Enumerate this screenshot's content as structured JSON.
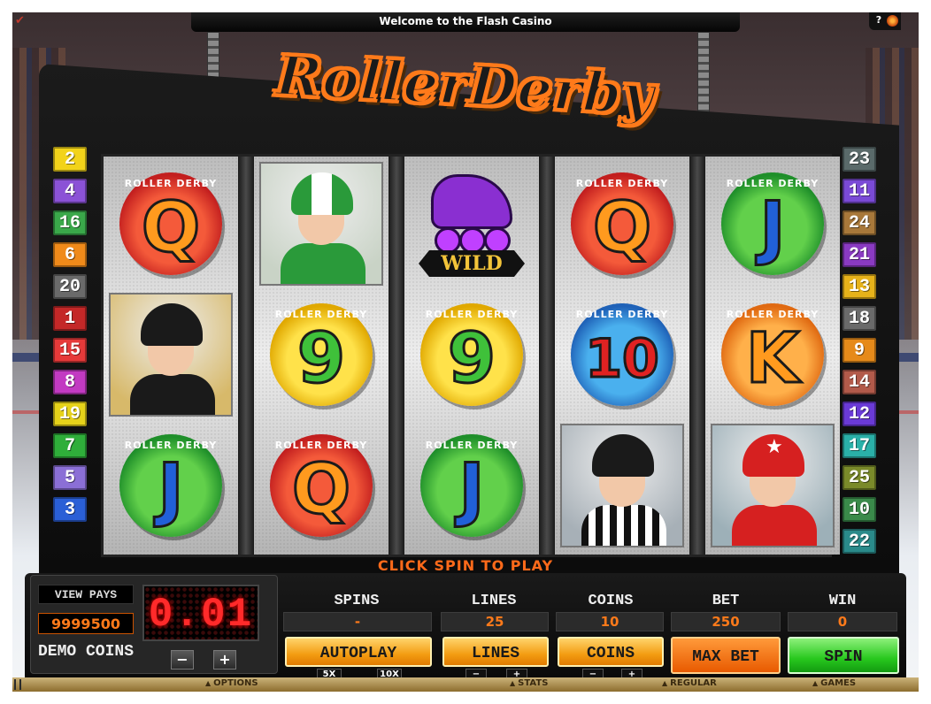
{
  "top_bar": {
    "title": "Welcome to the Flash Casino",
    "help_label": "?"
  },
  "logo": {
    "text": "RollerDerby"
  },
  "paylines_left": [
    {
      "n": "2",
      "color": "#f2d31a"
    },
    {
      "n": "4",
      "color": "#8b52d6"
    },
    {
      "n": "16",
      "color": "#3aa84a"
    },
    {
      "n": "6",
      "color": "#f08a1a"
    },
    {
      "n": "20",
      "color": "#6a6a6a"
    },
    {
      "n": "1",
      "color": "#c42828"
    },
    {
      "n": "15",
      "color": "#e63a3a"
    },
    {
      "n": "8",
      "color": "#c23ac2"
    },
    {
      "n": "19",
      "color": "#e6d21a"
    },
    {
      "n": "7",
      "color": "#2fae3a"
    },
    {
      "n": "5",
      "color": "#8b6fd6"
    },
    {
      "n": "3",
      "color": "#2a5fd6"
    }
  ],
  "paylines_right": [
    {
      "n": "23",
      "color": "#5a6a6a"
    },
    {
      "n": "11",
      "color": "#7a4ad6"
    },
    {
      "n": "24",
      "color": "#a8783a"
    },
    {
      "n": "21",
      "color": "#8a3ac2"
    },
    {
      "n": "13",
      "color": "#e6b21a"
    },
    {
      "n": "18",
      "color": "#6a6a6a"
    },
    {
      "n": "9",
      "color": "#e68a1a"
    },
    {
      "n": "14",
      "color": "#b25a4a"
    },
    {
      "n": "12",
      "color": "#6a3ad6"
    },
    {
      "n": "17",
      "color": "#2ab0a8"
    },
    {
      "n": "25",
      "color": "#7a8a2a"
    },
    {
      "n": "10",
      "color": "#3a8a4a"
    },
    {
      "n": "22",
      "color": "#2a8a8a"
    }
  ],
  "reels": [
    [
      {
        "kind": "letter",
        "glyph": "Q",
        "ring": "ROLLER DERBY",
        "coin": "red",
        "glyph_color": "orange"
      },
      {
        "kind": "picture",
        "name": "player-blonde-black-helmet"
      },
      {
        "kind": "letter",
        "glyph": "J",
        "ring": "ROLLER DERBY",
        "coin": "green",
        "glyph_color": "blue"
      }
    ],
    [
      {
        "kind": "picture",
        "name": "player-green-helmet"
      },
      {
        "kind": "letter",
        "glyph": "9",
        "ring": "ROLLER DERBY",
        "coin": "yellow",
        "glyph_color": "green"
      },
      {
        "kind": "letter",
        "glyph": "Q",
        "ring": "ROLLER DERBY",
        "coin": "red",
        "glyph_color": "orange"
      }
    ],
    [
      {
        "kind": "wild",
        "label": "WILD"
      },
      {
        "kind": "letter",
        "glyph": "9",
        "ring": "ROLLER DERBY",
        "coin": "yellow",
        "glyph_color": "green"
      },
      {
        "kind": "letter",
        "glyph": "J",
        "ring": "ROLLER DERBY",
        "coin": "green",
        "glyph_color": "blue"
      }
    ],
    [
      {
        "kind": "letter",
        "glyph": "Q",
        "ring": "ROLLER DERBY",
        "coin": "red",
        "glyph_color": "orange"
      },
      {
        "kind": "letter",
        "glyph": "10",
        "ring": "ROLLER DERBY",
        "coin": "blue",
        "glyph_color": "red"
      },
      {
        "kind": "picture",
        "name": "referee"
      }
    ],
    [
      {
        "kind": "letter",
        "glyph": "J",
        "ring": "ROLLER DERBY",
        "coin": "green",
        "glyph_color": "blue"
      },
      {
        "kind": "letter",
        "glyph": "K",
        "ring": "ROLLER DERBY",
        "coin": "orange",
        "glyph_color": "orange"
      },
      {
        "kind": "picture",
        "name": "player-red-star-helmet"
      }
    ]
  ],
  "prompt": "CLICK SPIN TO PLAY",
  "panel": {
    "view_pays": "VIEW PAYS",
    "balance": "9999500",
    "demo_coins": "DEMO COINS",
    "coin_value": "0.01",
    "minus": "−",
    "plus": "+",
    "spins_label": "SPINS",
    "spins_value": "-",
    "lines_label": "LINES",
    "lines_value": "25",
    "coins_label": "COINS",
    "coins_value": "10",
    "bet_label": "BET",
    "bet_value": "250",
    "win_label": "WIN",
    "win_value": "0",
    "autoplay": "AUTOPLAY",
    "lines_btn": "LINES",
    "coins_btn": "COINS",
    "max_bet": "MAX BET",
    "spin": "SPIN",
    "autoplay_5x": "5X",
    "autoplay_10x": "10X"
  },
  "menu": {
    "options": "OPTIONS",
    "stats": "STATS",
    "regular": "REGULAR",
    "games": "GAMES"
  },
  "colors": {
    "accent_orange": "#ff7a1a",
    "spin_green": "#28c81e"
  }
}
